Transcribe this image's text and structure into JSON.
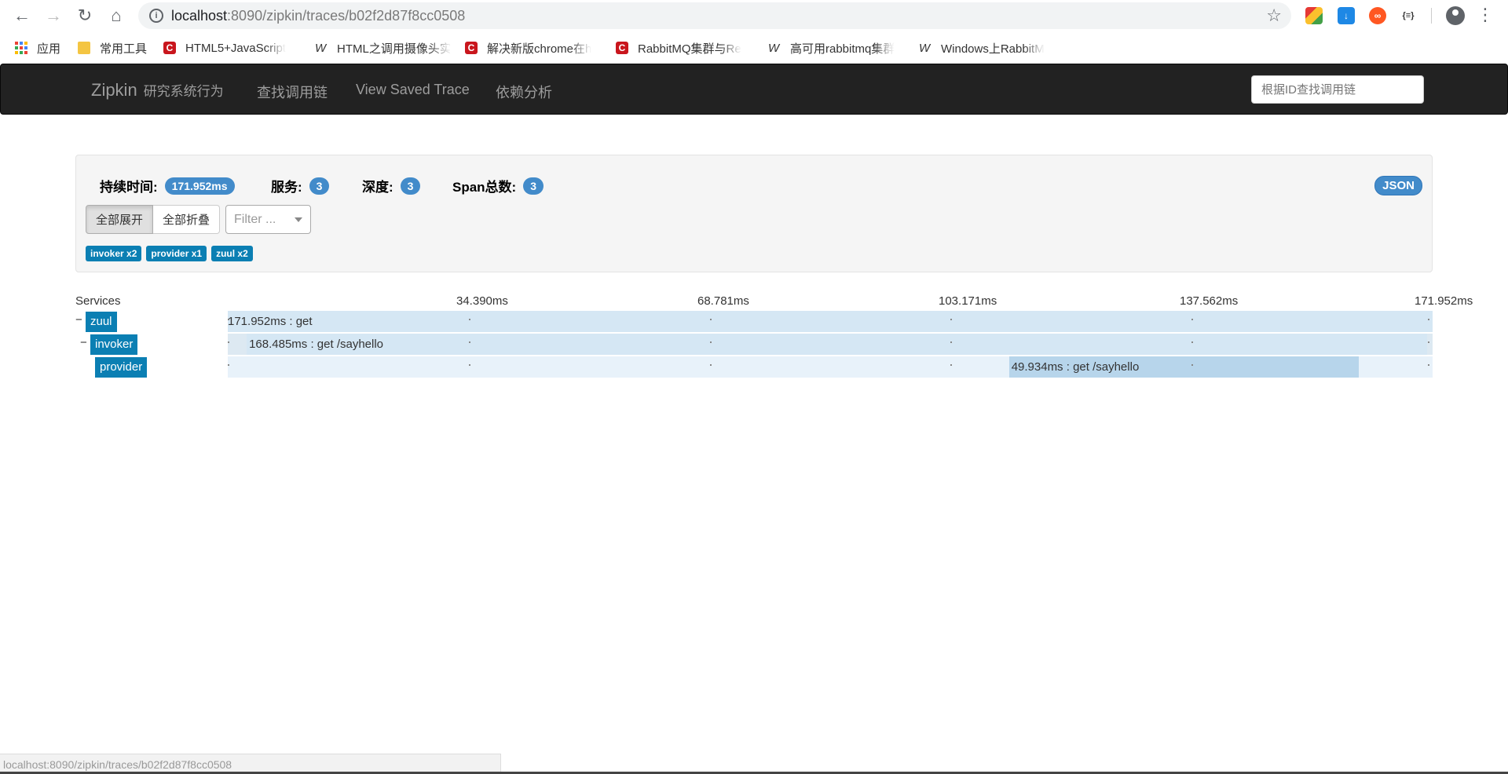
{
  "browser": {
    "url_host": "localhost",
    "url_rest": ":8090/zipkin/traces/b02f2d87f8cc0508",
    "info_glyph": "i",
    "status_url": "localhost:8090/zipkin/traces/b02f2d87f8cc0508",
    "extension_json_glyph": "{≡}"
  },
  "bookmarks": [
    {
      "label": "应用",
      "icon": "apps-icon"
    },
    {
      "label": "常用工具",
      "icon": "folder-icon"
    },
    {
      "label": "HTML5+JavaScript",
      "icon": "csdn-icon"
    },
    {
      "label": "HTML之调用摄像头实",
      "icon": "wiki-icon"
    },
    {
      "label": "解决新版chrome在h",
      "icon": "csdn-icon"
    },
    {
      "label": "RabbitMQ集群与Re",
      "icon": "csdn-icon"
    },
    {
      "label": "高可用rabbitmq集群",
      "icon": "wiki-icon"
    },
    {
      "label": "Windows上RabbitM",
      "icon": "wiki-icon"
    }
  ],
  "navbar": {
    "brand": "Zipkin",
    "brand_sub": "研究系统行为",
    "links": [
      "查找调用链",
      "View Saved Trace",
      "依赖分析"
    ],
    "search_placeholder": "根据ID查找调用链"
  },
  "summary": {
    "duration_label": "持续时间:",
    "duration_value": "171.952ms",
    "services_label": "服务:",
    "services_value": "3",
    "depth_label": "深度:",
    "depth_value": "3",
    "spans_label": "Span总数:",
    "spans_value": "3",
    "json_label": "JSON",
    "expand_all": "全部展开",
    "collapse_all": "全部折叠",
    "filter_placeholder": "Filter ...",
    "service_tags": [
      "invoker x2",
      "provider x1",
      "zuul x2"
    ]
  },
  "timeline": {
    "services_header": "Services",
    "ticks": [
      "34.390ms",
      "68.781ms",
      "103.171ms",
      "137.562ms",
      "171.952ms"
    ],
    "total_ms": 171.952,
    "rows": [
      {
        "service": "zuul",
        "expander": "−",
        "label": "171.952ms : get",
        "start_ms": 0,
        "duration_ms": 171.952
      },
      {
        "service": "invoker",
        "expander": "−",
        "label": "168.485ms : get /sayhello",
        "start_ms": 2.7,
        "duration_ms": 168.485
      },
      {
        "service": "provider",
        "expander": "",
        "label": "49.934ms : get /sayhello",
        "start_ms": 111.5,
        "duration_ms": 49.934
      }
    ]
  },
  "colors": {
    "accent": "#428bca",
    "service_tag": "#0b7fb3",
    "navbar_bg": "#222222"
  }
}
